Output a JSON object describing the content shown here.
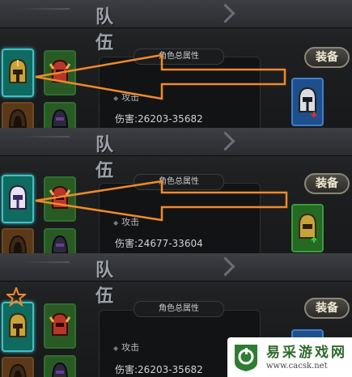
{
  "panels": [
    {
      "title": "队伍",
      "stats_header": "角色总属性",
      "attack_label": "攻击",
      "damage": "伤害:26203-35682",
      "equip_label": "装备"
    },
    {
      "title": "队伍",
      "stats_header": "角色总属性",
      "attack_label": "攻击",
      "damage": "伤害:24677-33604",
      "equip_label": "装备"
    },
    {
      "title": "队伍",
      "stats_header": "角色总属性",
      "attack_label": "攻击",
      "damage": "伤害:26203-35682",
      "equip_label": "装备"
    }
  ],
  "icons": {
    "selected_helmet_gold": "gold-helmet-icon",
    "selected_helmet_silver": "silver-helmet-icon",
    "red_helmet": "red-horned-helmet-icon",
    "dark_helmet": "dark-helmet-icon",
    "brown_hood": "hood-icon",
    "star": "star-icon",
    "down_arrow": "arrow-down-icon",
    "up_arrow": "arrow-up-icon"
  },
  "colors": {
    "arrow": "#f08a2a",
    "selected_border": "#3ec1c5",
    "equip_blue": "#3f7fc9",
    "equip_green": "#3a9b38"
  },
  "watermark": {
    "title": "易采游戏网",
    "url": "www.cacsk.net"
  }
}
